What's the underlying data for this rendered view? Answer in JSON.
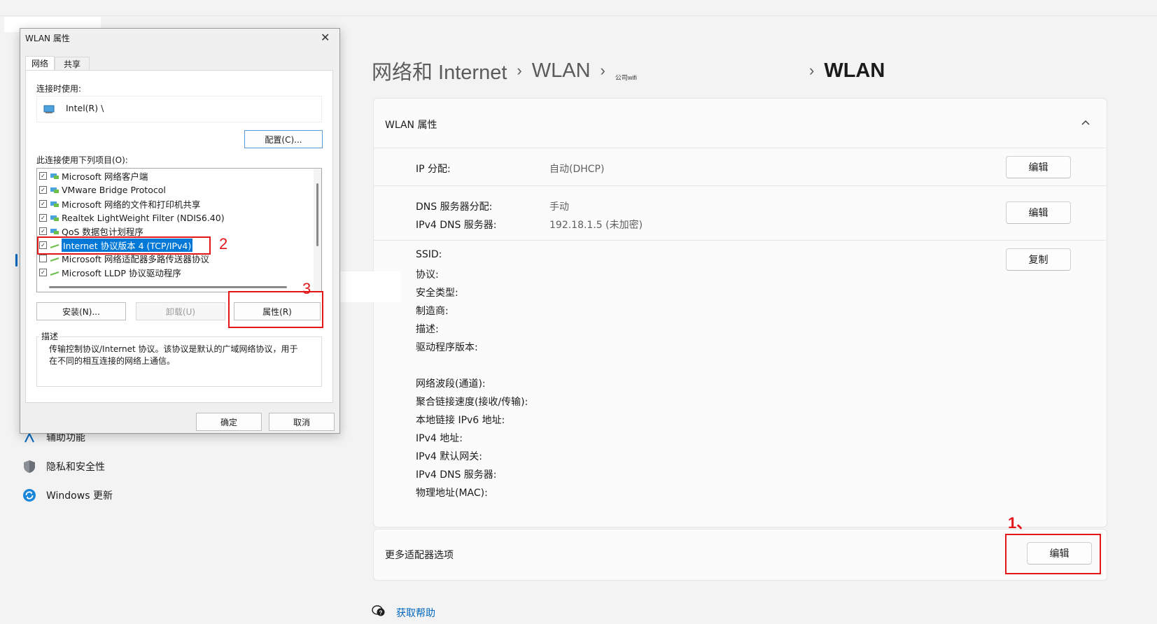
{
  "breadcrumb": {
    "part1": "网络和 Internet",
    "sep": "›",
    "part2": "WLAN",
    "small": "公司wifi",
    "last": "WLAN"
  },
  "wlan_props": {
    "header": "WLAN 属性",
    "ip_label": "IP 分配:",
    "ip_value": "自动(DHCP)",
    "edit_label": "编辑",
    "dns_label": "DNS 服务器分配:",
    "dns_value": "手动",
    "ipv4dns_label": "IPv4 DNS 服务器:",
    "ipv4dns_value": "192.18.1.5 (未加密)",
    "copy_label": "复制",
    "details": [
      "SSID:",
      "协议:",
      "安全类型:",
      "制造商:",
      "描述:",
      "驱动程序版本:"
    ],
    "details2": [
      "网络波段(通道):",
      "聚合链接速度(接收/传输):",
      "本地链接 IPv6 地址:",
      "IPv4 地址:",
      "IPv4 默认网关:",
      "IPv4 DNS 服务器:",
      "物理地址(MAC):"
    ]
  },
  "more_adapter": {
    "label": "更多适配器选项",
    "edit_label": "编辑"
  },
  "help": {
    "label": "获取帮助"
  },
  "sidebar": {
    "items": [
      "辅助功能",
      "隐私和安全性",
      "Windows 更新"
    ]
  },
  "dialog": {
    "title": "WLAN 属性",
    "close": "✕",
    "tab_network": "网络",
    "tab_share": "共享",
    "connect_using": "连接时使用:",
    "adapter": "Intel(R) \\",
    "configure": "配置(C)...",
    "items_label": "此连接使用下列项目(O):",
    "items": [
      {
        "label": "Microsoft 网络客户端",
        "checked": true
      },
      {
        "label": "VMware Bridge Protocol",
        "checked": true
      },
      {
        "label": "Microsoft 网络的文件和打印机共享",
        "checked": true
      },
      {
        "label": "Realtek LightWeight Filter (NDIS6.40)",
        "checked": true
      },
      {
        "label": "QoS 数据包计划程序",
        "checked": true
      },
      {
        "label": "Internet 协议版本 4 (TCP/IPv4)",
        "checked": true
      },
      {
        "label": "Microsoft 网络适配器多路传送器协议",
        "checked": false
      },
      {
        "label": "Microsoft LLDP 协议驱动程序",
        "checked": true
      }
    ],
    "install": "安装(N)...",
    "uninstall": "卸载(U)",
    "properties": "属性(R)",
    "desc_title": "描述",
    "desc_line1": "传输控制协议/Internet 协议。该协议是默认的广域网络协议，用于",
    "desc_line2": "在不同的相互连接的网络上通信。",
    "ok": "确定",
    "cancel": "取消"
  },
  "annotations": {
    "one": "1、",
    "two": "2",
    "three": "3"
  },
  "colors": {
    "accent": "#0067c0",
    "annotation_red": "#e3161a",
    "selection": "#0078d7"
  }
}
